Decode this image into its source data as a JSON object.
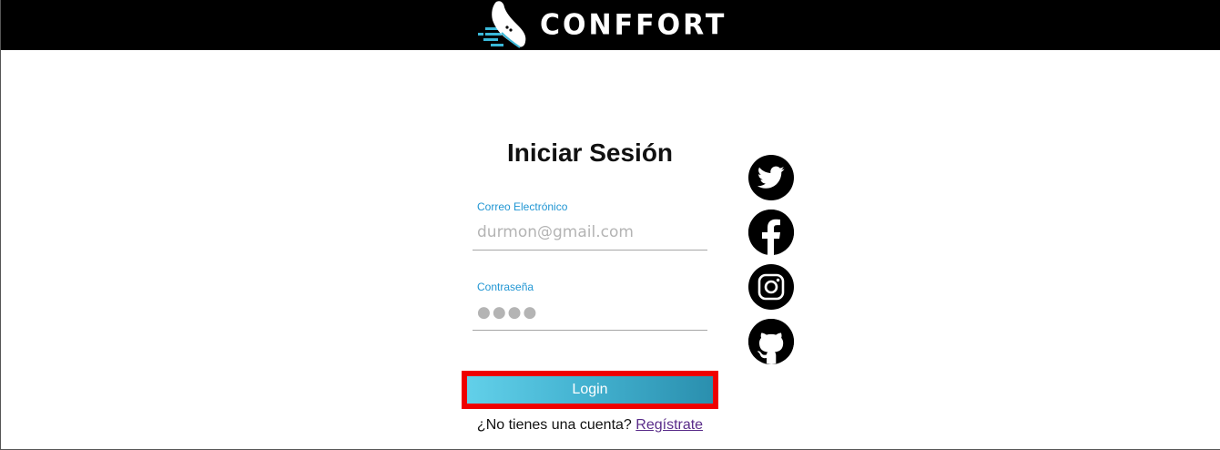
{
  "header": {
    "brand_name": "CONFFORT",
    "logo_icon": "sneaker-logo-icon",
    "background": "#000000"
  },
  "login": {
    "title": "Iniciar Sesión",
    "email": {
      "label": "Correo Electrónico",
      "placeholder": "durmon@gmail.com",
      "value": ""
    },
    "password": {
      "label": "Contraseña",
      "placeholder": "●●●●",
      "value": ""
    },
    "submit_label": "Login",
    "signup_prompt": "¿No tienes una cuenta?",
    "signup_link": "Regístrate",
    "accent_color": "#2196d3",
    "button_highlight_color": "#ee0000"
  },
  "social": [
    {
      "name": "twitter",
      "icon": "twitter-icon"
    },
    {
      "name": "facebook",
      "icon": "facebook-icon"
    },
    {
      "name": "instagram",
      "icon": "instagram-icon"
    },
    {
      "name": "github",
      "icon": "github-icon"
    }
  ]
}
